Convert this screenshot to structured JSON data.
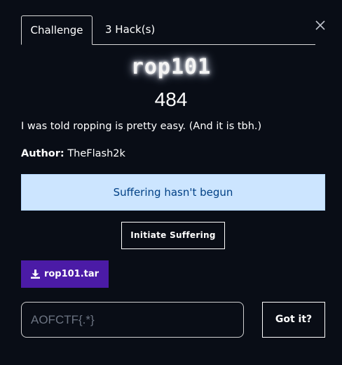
{
  "tabs": {
    "challenge_label": "Challenge",
    "hacks_label": "3 Hack(s)"
  },
  "challenge": {
    "name": "rop101",
    "points": "484",
    "description": "I was told ropping is pretty easy. (And it is tbh.)",
    "author_label": "Author:",
    "author_name": "TheFlash2k"
  },
  "status": {
    "message": "Suffering hasn't begun",
    "text_color": "#004085",
    "background_color": "#cce5ff"
  },
  "actions": {
    "initiate_label": "Initiate Suffering",
    "download_label": "rop101.tar",
    "download_icon": "download-icon",
    "download_color": "#4b1ba6",
    "submit_label": "Got it?"
  },
  "flag_input": {
    "placeholder": "AOFCTF{.*}",
    "value": ""
  },
  "icons": {
    "close": "close-icon"
  }
}
